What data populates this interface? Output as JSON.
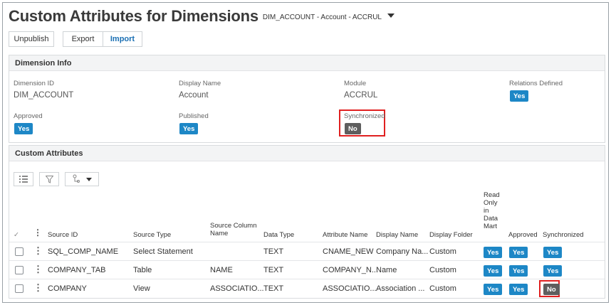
{
  "header": {
    "title": "Custom Attributes for Dimensions",
    "subtitle": "DIM_ACCOUNT - Account - ACCRUL"
  },
  "toolbar": {
    "unpublish_label": "Unpublish",
    "export_label": "Export",
    "import_label": "Import"
  },
  "dimension_info": {
    "title": "Dimension Info",
    "dimension_id_label": "Dimension ID",
    "dimension_id_value": "DIM_ACCOUNT",
    "display_name_label": "Display Name",
    "display_name_value": "Account",
    "module_label": "Module",
    "module_value": "ACCRUL",
    "relations_label": "Relations Defined",
    "relations_value": "Yes",
    "approved_label": "Approved",
    "approved_value": "Yes",
    "published_label": "Published",
    "published_value": "Yes",
    "synchronized_label": "Synchronized",
    "synchronized_value": "No"
  },
  "custom_attributes": {
    "title": "Custom Attributes",
    "columns": {
      "check": "✓",
      "source_id": "Source ID",
      "source_type": "Source Type",
      "source_column_name": "Source Column\nName",
      "data_type": "Data Type",
      "attribute_name": "Attribute Name",
      "display_name": "Display Name",
      "display_folder": "Display Folder",
      "read_only": "Read\nOnly\nin\nData\nMart",
      "approved": "Approved",
      "synchronized": "Synchronized"
    },
    "rows": [
      {
        "source_id": "SQL_COMP_NAME",
        "source_type": "Select Statement",
        "source_column_name": "",
        "data_type": "TEXT",
        "attribute_name": "CNAME_NEW",
        "display_name": "Company Na...",
        "display_folder": "Custom",
        "read_only": "Yes",
        "approved": "Yes",
        "synchronized": "Yes"
      },
      {
        "source_id": "COMPANY_TAB",
        "source_type": "Table",
        "source_column_name": "NAME",
        "data_type": "TEXT",
        "attribute_name": "COMPANY_N...",
        "display_name": "Name",
        "display_folder": "Custom",
        "read_only": "Yes",
        "approved": "Yes",
        "synchronized": "Yes"
      },
      {
        "source_id": "COMPANY",
        "source_type": "View",
        "source_column_name": "ASSOCIATIO...",
        "data_type": "TEXT",
        "attribute_name": "ASSOCIATIO...",
        "display_name": "Association ...",
        "display_folder": "Custom",
        "read_only": "Yes",
        "approved": "Yes",
        "synchronized": "No"
      }
    ]
  },
  "icons": {
    "dropdown": "caret-down-icon",
    "list": "list-icon",
    "filter": "filter-icon",
    "group": "group-icon",
    "row_menu": "vertical-dots-icon"
  },
  "colors": {
    "yes_badge": "#1d87c6",
    "no_badge": "#5e5e5e",
    "highlight": "#e02020",
    "import_text": "#1a6fb3"
  }
}
